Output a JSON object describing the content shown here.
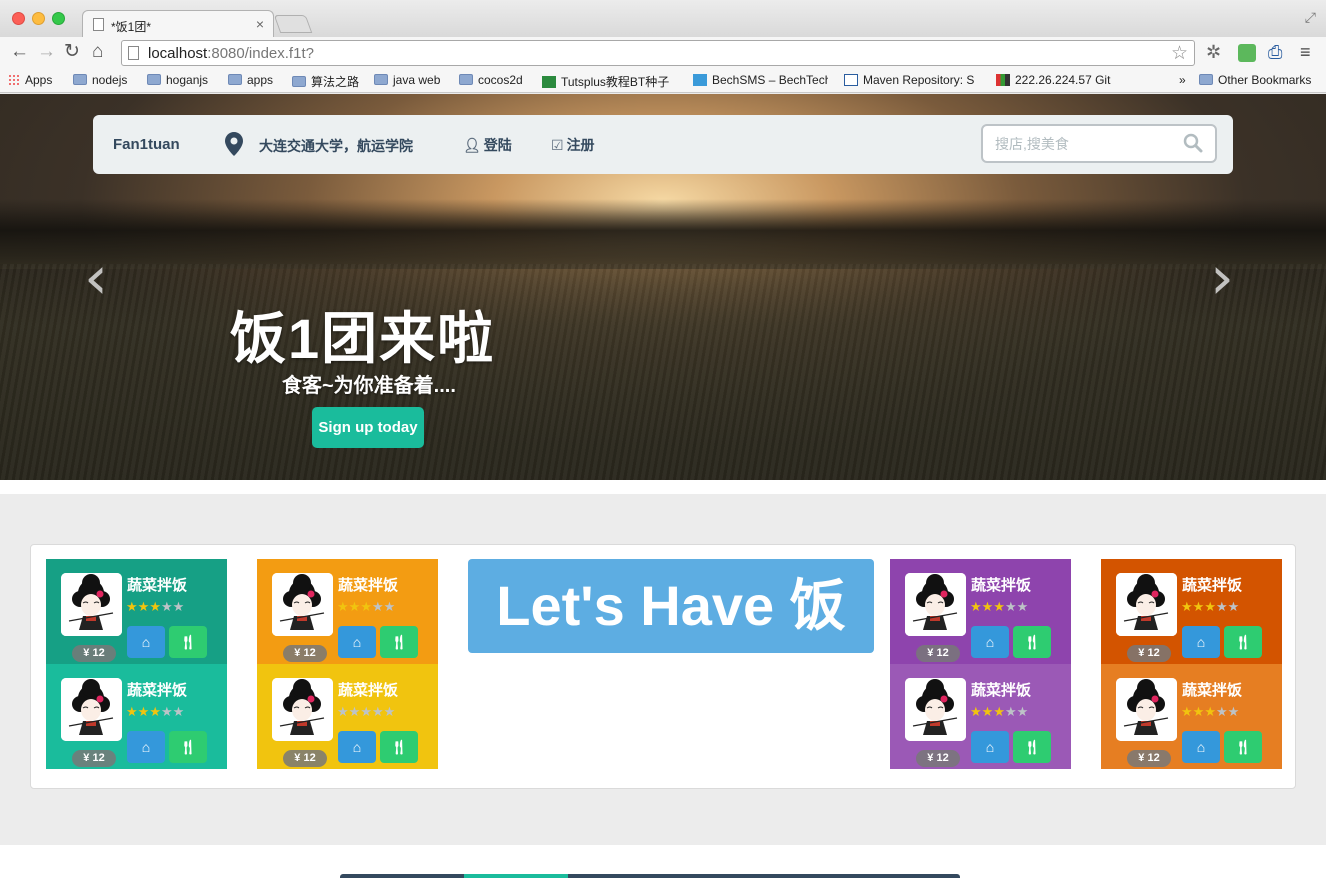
{
  "browser": {
    "tab_title": "*饭1团*",
    "url_host": "localhost",
    "url_rest": ":8080/index.f1t?",
    "bookmarks": [
      {
        "label": "Apps"
      },
      {
        "label": "nodejs"
      },
      {
        "label": "hoganjs"
      },
      {
        "label": "apps"
      },
      {
        "label": "算法之路"
      },
      {
        "label": "java web"
      },
      {
        "label": "cocos2d"
      },
      {
        "label": "Tutsplus教程BT种子"
      },
      {
        "label": "BechSMS – BechTech"
      },
      {
        "label": "Maven Repository: S"
      },
      {
        "label": "222.26.224.57 Git"
      }
    ],
    "overflow": "»",
    "other_bookmarks": "Other Bookmarks"
  },
  "nav": {
    "brand": "Fan1tuan",
    "location": "大连交通大学，航运学院",
    "login": "登陆",
    "register": "注册",
    "search_placeholder": "搜店,搜美食"
  },
  "hero": {
    "title": "饭1团来啦",
    "subtitle": "食客~为你准备着....",
    "cta": "Sign up today"
  },
  "banner": "Let's Have 饭",
  "cards": [
    {
      "name": "蔬菜拌饭",
      "price": "¥ 12",
      "rating": 3,
      "color": "#16a085"
    },
    {
      "name": "蔬菜拌饭",
      "price": "¥ 12",
      "rating": 3,
      "color": "#1abc9c"
    },
    {
      "name": "蔬菜拌饭",
      "price": "¥ 12",
      "rating": 3,
      "color": "#f39c12"
    },
    {
      "name": "蔬菜拌饭",
      "price": "¥ 12",
      "rating": 0,
      "color": "#f1c40f"
    },
    {
      "name": "蔬菜拌饭",
      "price": "¥ 12",
      "rating": 3,
      "color": "#8e44ad"
    },
    {
      "name": "蔬菜拌饭",
      "price": "¥ 12",
      "rating": 3,
      "color": "#9b59b6"
    },
    {
      "name": "蔬菜拌饭",
      "price": "¥ 12",
      "rating": 3,
      "color": "#d35400"
    },
    {
      "name": "蔬菜拌饭",
      "price": "¥ 12",
      "rating": 3,
      "color": "#e67e22"
    }
  ]
}
